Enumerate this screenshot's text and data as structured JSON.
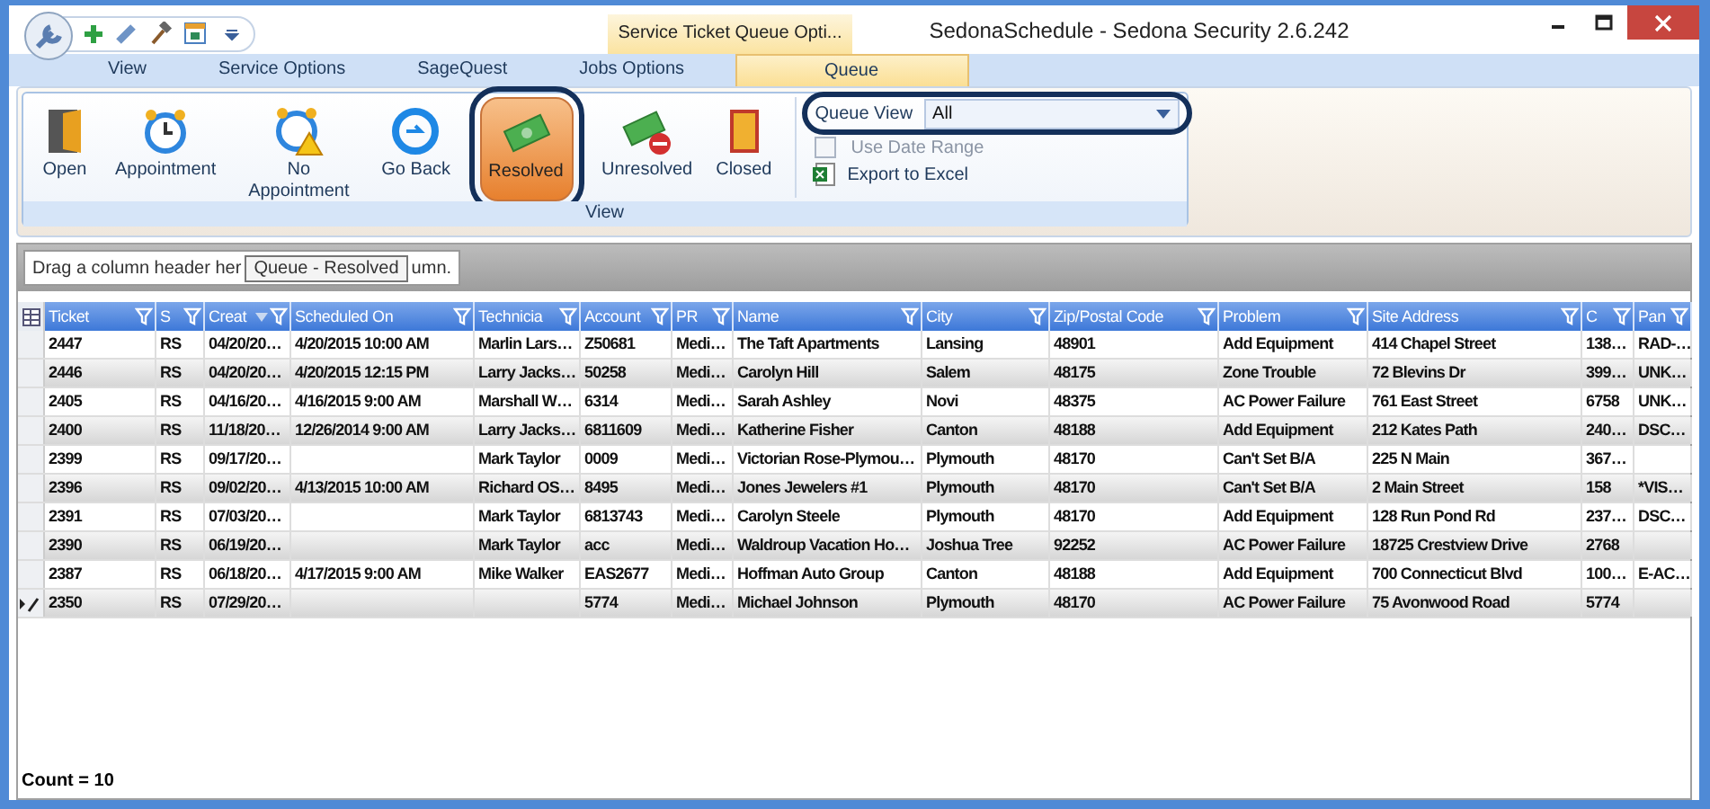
{
  "window": {
    "title": "SedonaSchedule - Sedona Security 2.6.242",
    "context_tab": "Service Ticket Queue Opti..."
  },
  "ribbon_tabs": [
    {
      "label": "View",
      "selected": false
    },
    {
      "label": "Service Options",
      "selected": false
    },
    {
      "label": "SageQuest",
      "selected": false
    },
    {
      "label": "Jobs Options",
      "selected": false
    },
    {
      "label": "Queue",
      "selected": true
    }
  ],
  "ribbon_buttons": [
    {
      "label": "Open",
      "selected": false,
      "highlighted": false
    },
    {
      "label": "Appointment",
      "selected": false,
      "highlighted": false
    },
    {
      "label": "No Appointment",
      "selected": false,
      "highlighted": false
    },
    {
      "label": "Go Back",
      "selected": false,
      "highlighted": false
    },
    {
      "label": "Resolved",
      "selected": true,
      "highlighted": true
    },
    {
      "label": "Unresolved",
      "selected": false,
      "highlighted": false
    },
    {
      "label": "Closed",
      "selected": false,
      "highlighted": false
    }
  ],
  "queue_view": {
    "label": "Queue View",
    "value": "All",
    "highlighted": true
  },
  "use_date_range": {
    "label": "Use Date Range",
    "checked": false,
    "disabled": true
  },
  "export": {
    "label": "Export to Excel"
  },
  "group_label": "View",
  "group_panel": {
    "hint_start": "Drag a column header her",
    "hint_end": "umn.",
    "tooltip": "Queue - Resolved"
  },
  "columns": [
    {
      "label": "Ticket",
      "sorted": false
    },
    {
      "label": "S",
      "sorted": false
    },
    {
      "label": "Creat",
      "sorted": true
    },
    {
      "label": "Scheduled On",
      "sorted": false
    },
    {
      "label": "Technicia",
      "sorted": false
    },
    {
      "label": "Account",
      "sorted": false
    },
    {
      "label": "PR",
      "sorted": false
    },
    {
      "label": "Name",
      "sorted": false
    },
    {
      "label": "City",
      "sorted": false
    },
    {
      "label": "Zip/Postal Code",
      "sorted": false
    },
    {
      "label": "Problem",
      "sorted": false
    },
    {
      "label": "Site Address",
      "sorted": false
    },
    {
      "label": "C",
      "sorted": false
    },
    {
      "label": "Pan",
      "sorted": false
    }
  ],
  "rows": [
    {
      "current": false,
      "cells": [
        "2447",
        "RS",
        "04/20/20…",
        "4/20/2015 10:00 AM",
        "Marlin Lars…",
        "Z50681",
        "Medi…",
        "The Taft Apartments",
        "Lansing",
        "48901",
        "Add Equipment",
        "414 Chapel Street",
        "138…",
        "RAD-…"
      ]
    },
    {
      "current": false,
      "cells": [
        "2446",
        "RS",
        "04/20/20…",
        "4/20/2015 12:15 PM",
        "Larry Jacks…",
        "50258",
        "Medi…",
        "Carolyn Hill",
        "Salem",
        "48175",
        "Zone Trouble",
        "72 Blevins Dr",
        "399…",
        "UNK…"
      ]
    },
    {
      "current": false,
      "cells": [
        "2405",
        "RS",
        "04/16/20…",
        "4/16/2015 9:00 AM",
        "Marshall W…",
        "6314",
        "Medi…",
        "Sarah Ashley",
        "Novi",
        "48375",
        "AC Power Failure",
        "761 East Street",
        "6758",
        "UNK…"
      ]
    },
    {
      "current": false,
      "cells": [
        "2400",
        "RS",
        "11/18/20…",
        "12/26/2014 9:00 AM",
        "Larry Jacks…",
        "6811609",
        "Medi…",
        "Katherine Fisher",
        "Canton",
        "48188",
        "Add Equipment",
        "212  Kates Path",
        "240…",
        "DSC…"
      ]
    },
    {
      "current": false,
      "cells": [
        "2399",
        "RS",
        "09/17/20…",
        "",
        "Mark Taylor",
        "0009",
        "Medi…",
        "Victorian Rose-Plymou…",
        "Plymouth",
        "48170",
        "Can't Set B/A",
        "225 N Main",
        "367…",
        ""
      ]
    },
    {
      "current": false,
      "cells": [
        "2396",
        "RS",
        "09/02/20…",
        "4/13/2015 10:00 AM",
        "Richard OS…",
        "8495",
        "Medi…",
        "Jones Jewelers #1",
        "Plymouth",
        "48170",
        "Can't Set B/A",
        "2 Main Street",
        "158",
        "*VIS…"
      ]
    },
    {
      "current": false,
      "cells": [
        "2391",
        "RS",
        "07/03/20…",
        "",
        "Mark Taylor",
        "6813743",
        "Medi…",
        "Carolyn Steele",
        "Plymouth",
        "48170",
        "Add Equipment",
        "128  Run Pond Rd",
        "237…",
        "DSC…"
      ]
    },
    {
      "current": false,
      "cells": [
        "2390",
        "RS",
        "06/19/20…",
        "",
        "Mark Taylor",
        "acc",
        "Medi…",
        "Waldroup Vacation Ho…",
        "Joshua Tree",
        "92252",
        "AC Power Failure",
        "18725 Crestview Drive",
        "2768",
        ""
      ]
    },
    {
      "current": false,
      "cells": [
        "2387",
        "RS",
        "06/18/20…",
        "4/17/2015 9:00 AM",
        "Mike Walker",
        "EAS2677",
        "Medi…",
        "Hoffman Auto Group",
        "Canton",
        "48188",
        "Add Equipment",
        "700 Connecticut Blvd",
        "100…",
        "E-AC…"
      ]
    },
    {
      "current": true,
      "cells": [
        "2350",
        "RS",
        "07/29/20…",
        "",
        "",
        "5774",
        "Medi…",
        "Michael Johnson",
        "Plymouth",
        "48170",
        "AC Power Failure",
        "75 Avonwood Road",
        "5774",
        ""
      ]
    }
  ],
  "footer": "Count = 10"
}
